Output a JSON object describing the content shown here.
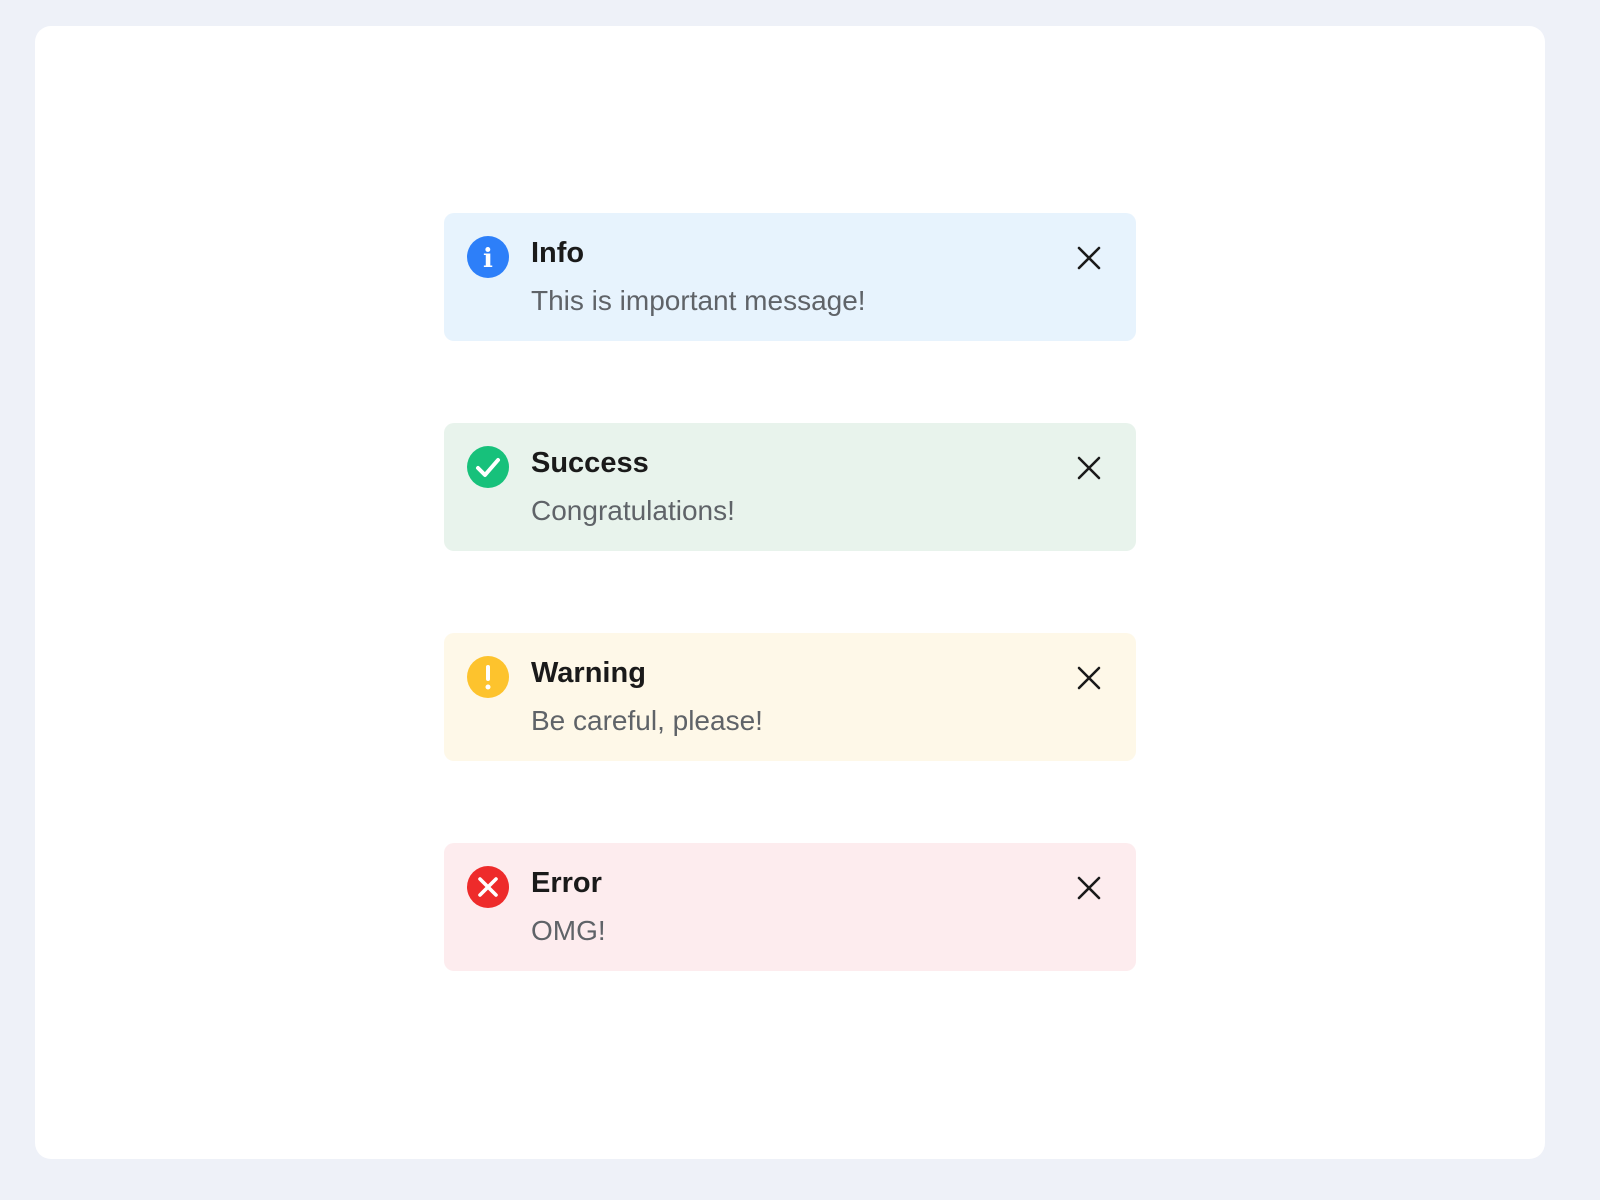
{
  "alerts": [
    {
      "kind": "info",
      "title": "Info",
      "message": "This is important message!",
      "icon": "info-icon",
      "accent": "#2d7ff9",
      "background": "#e7f3fd"
    },
    {
      "kind": "success",
      "title": "Success",
      "message": "Congratulations!",
      "icon": "check-circle-icon",
      "accent": "#17c17b",
      "background": "#e8f3ec"
    },
    {
      "kind": "warning",
      "title": "Warning",
      "message": "Be careful, please!",
      "icon": "exclamation-icon",
      "accent": "#fdc32d",
      "background": "#fef8e8"
    },
    {
      "kind": "error",
      "title": "Error",
      "message": "OMG!",
      "icon": "x-circle-icon",
      "accent": "#ee2b2b",
      "background": "#fdecee"
    }
  ],
  "close_icon": "close-icon"
}
